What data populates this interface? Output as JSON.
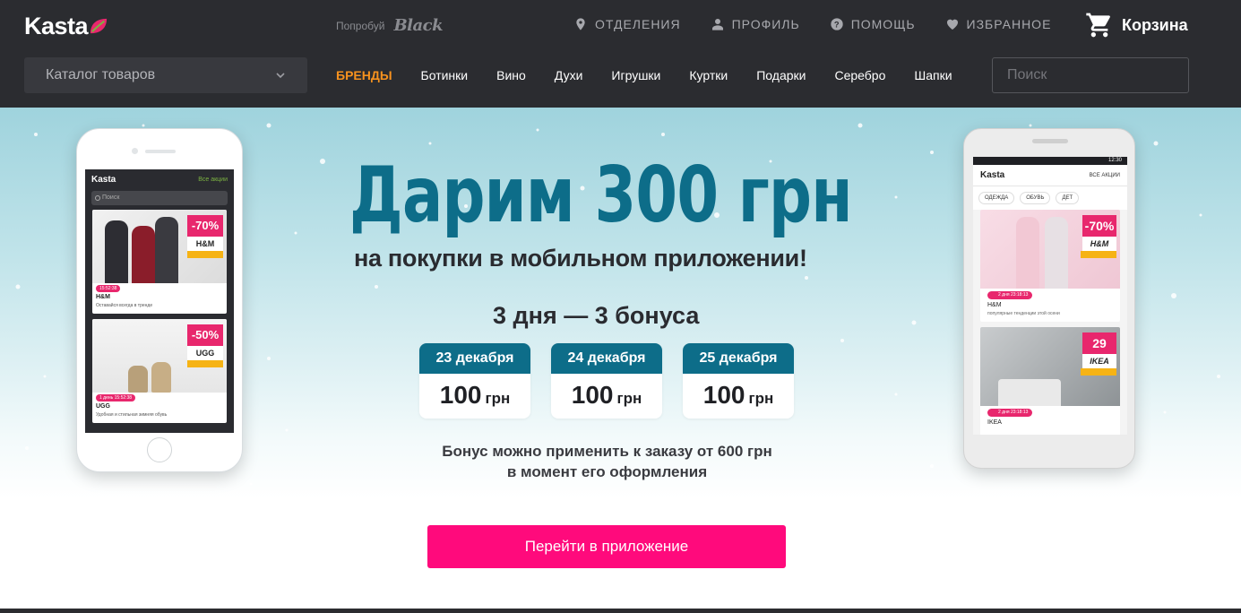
{
  "header": {
    "logo": "Kasta",
    "try_text": "Попробуй",
    "try_brand": "Black",
    "nav": [
      {
        "label": "ОТДЕЛЕНИЯ",
        "icon": "location-pin-icon"
      },
      {
        "label": "ПРОФИЛЬ",
        "icon": "user-icon"
      },
      {
        "label": "ПОМОЩЬ",
        "icon": "help-icon"
      },
      {
        "label": "ИЗБРАННОЕ",
        "icon": "heart-icon"
      }
    ],
    "cart": "Корзина",
    "catalog": "Каталог товаров",
    "categories": [
      "БРЕНДЫ",
      "Ботинки",
      "Вино",
      "Духи",
      "Игрушки",
      "Куртки",
      "Подарки",
      "Серебро",
      "Шапки"
    ],
    "search_placeholder": "Поиск"
  },
  "banner": {
    "headline": "Дарим 300 грн",
    "subline": "на покупки в мобильном приложении!",
    "days": "3  дня — 3 бонуса",
    "bonuses": [
      {
        "date": "23 декабря",
        "amount": "100",
        "currency": "грн"
      },
      {
        "date": "24 декабря",
        "amount": "100",
        "currency": "грн"
      },
      {
        "date": "25 декабря",
        "amount": "100",
        "currency": "грн"
      }
    ],
    "note_line1": "Бонус можно применить к заказу от 600 грн",
    "note_line2": "в момент его оформления",
    "cta": "Перейти в приложение"
  },
  "phone_left": {
    "logo": "Kasta",
    "all_promos": "Все акции",
    "search": "Поиск",
    "products": [
      {
        "sale": "-70%",
        "brand": "H&M",
        "timer": "15:52:38",
        "name": "H&M",
        "desc": "Оставайся всегда в тренде"
      },
      {
        "sale": "-50%",
        "brand": "UGG",
        "timer": "1 день 15:52:38",
        "name": "UGG",
        "desc": "Удобная и стильная зимняя обувь"
      }
    ]
  },
  "phone_right": {
    "status_time": "12:30",
    "logo": "Kasta",
    "all_promos": "ВСЕ АКЦИИ",
    "chips": [
      "ОДЕЖДА",
      "ОБУВЬ",
      "ДЕТ"
    ],
    "products": [
      {
        "sale": "-70%",
        "brand": "H&M",
        "timer": "2 дня 23:18:13",
        "name": "H&M",
        "desc": "популярные тенденции этой осени"
      },
      {
        "sale": "29",
        "brand": "IKEA",
        "timer": "2 дня 23:18:13",
        "name": "IKEA",
        "desc": ""
      }
    ]
  },
  "colors": {
    "header_bg": "#2b2c30",
    "accent_teal": "#0d6d89",
    "cta_pink": "#ff0a7c",
    "brands_orange": "#f7921e",
    "logo_leaf": "#e8276d"
  }
}
